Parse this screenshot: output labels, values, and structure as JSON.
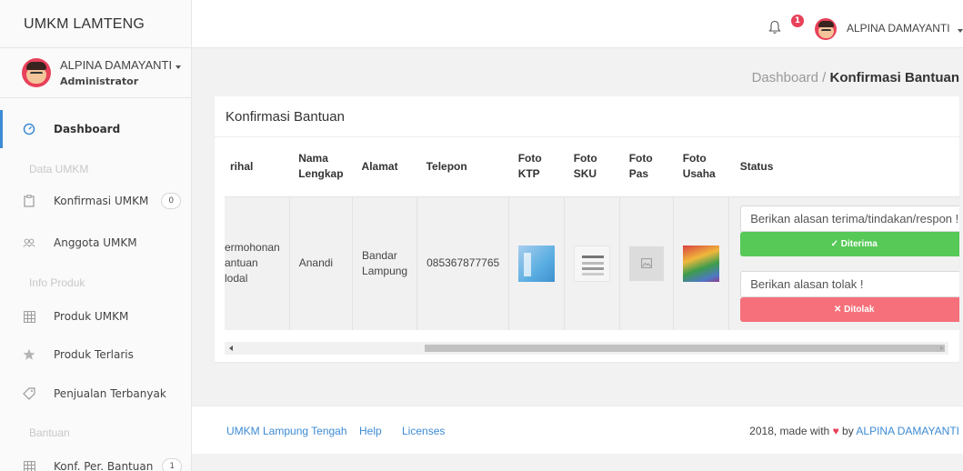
{
  "brand": "UMKM LAMTENG",
  "user": {
    "name": "ALPINA DAMAYANTI",
    "role": "Administrator"
  },
  "sidebar": {
    "items": [
      {
        "label": "Dashboard"
      },
      {
        "label": "Konfirmasi UMKM",
        "badge": "0"
      },
      {
        "label": "Anggota UMKM"
      },
      {
        "label": "Produk UMKM"
      },
      {
        "label": "Produk Terlaris"
      },
      {
        "label": "Penjualan Terbanyak"
      },
      {
        "label": "Konf. Per. Bantuan",
        "badge": "1"
      }
    ],
    "sections": [
      "Data UMKM",
      "Info Produk",
      "Bantuan"
    ]
  },
  "topbar": {
    "notif_count": "1",
    "user_name": "ALPINA DAMAYANTI"
  },
  "breadcrumb": {
    "parent": "Dashboard",
    "separator": " / ",
    "current": "Konfirmasi Bantuan"
  },
  "card": {
    "title": "Konfirmasi Bantuan"
  },
  "table": {
    "headers": [
      "rihal",
      "Nama Lengkap",
      "Alamat",
      "Telepon",
      "Foto KTP",
      "Foto SKU",
      "Foto Pas",
      "Foto Usaha",
      "Status"
    ],
    "row": {
      "perihal": "ermohonan antuan lodal",
      "nama": "Anandi",
      "alamat": "Bandar Lampung",
      "telepon": "085367877765"
    },
    "accept_placeholder": "Berikan alasan terima/tindakan/respon !",
    "accept_label": "✓ Diterima",
    "reject_placeholder": "Berikan alasan tolak !",
    "reject_label": "✕ Ditolak"
  },
  "footer": {
    "links": [
      "UMKM Lampung Tengah",
      "Help",
      "Licenses"
    ],
    "credit_prefix": "2018, made with",
    "credit_by": "by",
    "credit_author": "ALPINA DAMAYANTI"
  },
  "colors": {
    "accent": "#3d8bd4",
    "success": "#56c957",
    "danger": "#f5707a",
    "badge": "#e8415a"
  }
}
